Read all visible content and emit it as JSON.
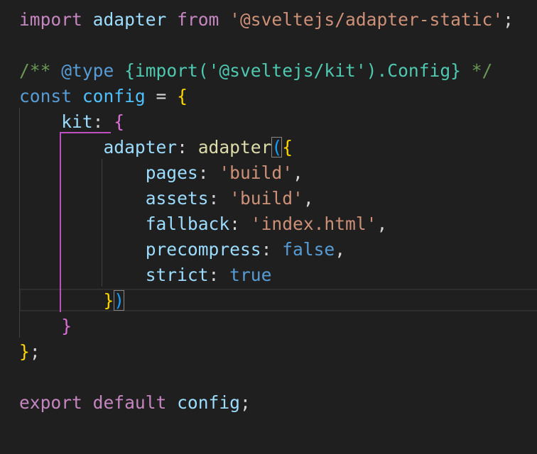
{
  "editor": {
    "lines": [
      {
        "tokens": [
          {
            "t": "import",
            "c": "kw"
          },
          {
            "t": " "
          },
          {
            "t": "adapter",
            "c": "var"
          },
          {
            "t": " "
          },
          {
            "t": "from",
            "c": "kw"
          },
          {
            "t": " "
          },
          {
            "t": "'@sveltejs/adapter-static'",
            "c": "str"
          },
          {
            "t": ";",
            "c": "pun"
          }
        ]
      },
      {
        "tokens": []
      },
      {
        "tokens": [
          {
            "t": "/** ",
            "c": "com"
          },
          {
            "t": "@type",
            "c": "tag"
          },
          {
            "t": " "
          },
          {
            "t": "{",
            "c": "typ"
          },
          {
            "t": "import",
            "c": "typ"
          },
          {
            "t": "(",
            "c": "typ"
          },
          {
            "t": "'@sveltejs/kit'",
            "c": "typ"
          },
          {
            "t": ").Config}",
            "c": "typ"
          },
          {
            "t": " */",
            "c": "com"
          }
        ]
      },
      {
        "tokens": [
          {
            "t": "const",
            "c": "kw-blue"
          },
          {
            "t": " "
          },
          {
            "t": "config",
            "c": "cvar"
          },
          {
            "t": " = "
          },
          {
            "t": "{",
            "c": "br1"
          }
        ]
      },
      {
        "tokens": [
          {
            "t": "    "
          },
          {
            "t": "kit",
            "c": "var"
          },
          {
            "t": ": "
          },
          {
            "t": "{",
            "c": "br2"
          }
        ]
      },
      {
        "tokens": [
          {
            "t": "        "
          },
          {
            "t": "adapter",
            "c": "var"
          },
          {
            "t": ": "
          },
          {
            "t": "adapter",
            "c": "fn"
          },
          {
            "t": "(",
            "c": "br3",
            "box": true
          },
          {
            "t": "{",
            "c": "br1"
          }
        ]
      },
      {
        "tokens": [
          {
            "t": "            "
          },
          {
            "t": "pages",
            "c": "var"
          },
          {
            "t": ": "
          },
          {
            "t": "'build'",
            "c": "str"
          },
          {
            "t": ","
          }
        ]
      },
      {
        "tokens": [
          {
            "t": "            "
          },
          {
            "t": "assets",
            "c": "var"
          },
          {
            "t": ": "
          },
          {
            "t": "'build'",
            "c": "str"
          },
          {
            "t": ","
          }
        ]
      },
      {
        "tokens": [
          {
            "t": "            "
          },
          {
            "t": "fallback",
            "c": "var"
          },
          {
            "t": ": "
          },
          {
            "t": "'index.html'",
            "c": "str"
          },
          {
            "t": ","
          }
        ]
      },
      {
        "tokens": [
          {
            "t": "            "
          },
          {
            "t": "precompress",
            "c": "var"
          },
          {
            "t": ": "
          },
          {
            "t": "false",
            "c": "kw-blue"
          },
          {
            "t": ","
          }
        ]
      },
      {
        "tokens": [
          {
            "t": "            "
          },
          {
            "t": "strict",
            "c": "var"
          },
          {
            "t": ": "
          },
          {
            "t": "true",
            "c": "kw-blue"
          }
        ]
      },
      {
        "tokens": [
          {
            "t": "        "
          },
          {
            "t": "}",
            "c": "br1"
          },
          {
            "t": ")",
            "c": "br3",
            "box": true
          }
        ]
      },
      {
        "tokens": [
          {
            "t": "    "
          },
          {
            "t": "}",
            "c": "br2"
          }
        ]
      },
      {
        "tokens": [
          {
            "t": "}",
            "c": "br1"
          },
          {
            "t": ";"
          }
        ]
      },
      {
        "tokens": []
      },
      {
        "tokens": [
          {
            "t": "export",
            "c": "kw"
          },
          {
            "t": " "
          },
          {
            "t": "default",
            "c": "kw"
          },
          {
            "t": " "
          },
          {
            "t": "config",
            "c": "var"
          },
          {
            "t": ";"
          }
        ]
      }
    ],
    "colors": {
      "background": "#1f1f1f",
      "active_guide": "#c04fc0",
      "indent_guide": "#404040"
    }
  }
}
